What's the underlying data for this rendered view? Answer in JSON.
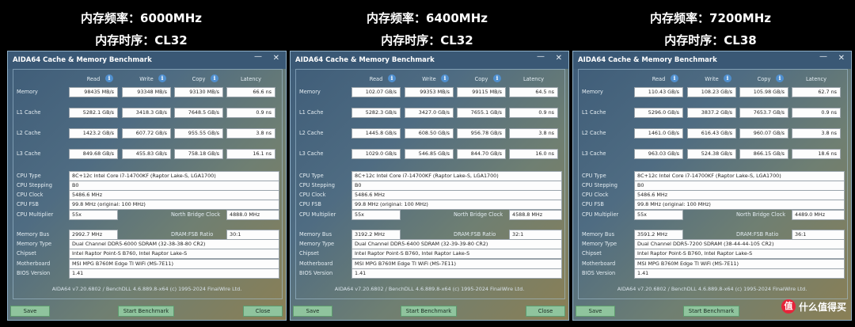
{
  "benchmarks": [
    {
      "header_freq": "内存频率：6000MHz",
      "header_cl": "内存时序：CL32",
      "title": "AIDA64 Cache & Memory Benchmark",
      "col_read": "Read",
      "col_write": "Write",
      "col_copy": "Copy",
      "col_latency": "Latency",
      "rows": [
        {
          "label": "Memory",
          "read": "98435 MB/s",
          "write": "93348 MB/s",
          "copy": "93130 MB/s",
          "latency": "66.6 ns"
        },
        {
          "label": "L1 Cache",
          "read": "5282.1 GB/s",
          "write": "3418.3 GB/s",
          "copy": "7648.5 GB/s",
          "latency": "0.9 ns"
        },
        {
          "label": "L2 Cache",
          "read": "1423.2 GB/s",
          "write": "607.72 GB/s",
          "copy": "955.55 GB/s",
          "latency": "3.8 ns"
        },
        {
          "label": "L3 Cache",
          "read": "849.68 GB/s",
          "write": "455.83 GB/s",
          "copy": "758.18 GB/s",
          "latency": "16.1 ns"
        }
      ],
      "cpu_type_label": "CPU Type",
      "cpu_type": "8C+12c Intel Core i7-14700KF  (Raptor Lake-S, LGA1700)",
      "cpu_stepping_label": "CPU Stepping",
      "cpu_stepping": "B0",
      "cpu_clock_label": "CPU Clock",
      "cpu_clock": "5486.6 MHz",
      "cpu_fsb_label": "CPU FSB",
      "cpu_fsb": "99.8 MHz  (original: 100 MHz)",
      "cpu_mult_label": "CPU Multiplier",
      "cpu_mult": "55x",
      "nb_clock_label": "North Bridge Clock",
      "nb_clock": "4888.0 MHz",
      "mem_bus_label": "Memory Bus",
      "mem_bus": "2992.7 MHz",
      "dram_ratio_label": "DRAM:FSB Ratio",
      "dram_ratio": "30:1",
      "mem_type_label": "Memory Type",
      "mem_type": "Dual Channel DDR5-6000 SDRAM  (32-38-38-80 CR2)",
      "chipset_label": "Chipset",
      "chipset": "Intel Raptor Point-S B760, Intel Raptor Lake-S",
      "mobo_label": "Motherboard",
      "mobo": "MSI MPG B760M Edge TI WiFi (MS-7E11)",
      "bios_label": "BIOS Version",
      "bios": "1.41",
      "footer": "AIDA64 v7.20.6802 / BenchDLL 4.6.889.8-x64  (c) 1995-2024 FinalWire Ltd.",
      "save": "Save",
      "start": "Start Benchmark",
      "close": "Close"
    },
    {
      "header_freq": "内存频率：6400MHz",
      "header_cl": "内存时序：CL32",
      "title": "AIDA64 Cache & Memory Benchmark",
      "col_read": "Read",
      "col_write": "Write",
      "col_copy": "Copy",
      "col_latency": "Latency",
      "rows": [
        {
          "label": "Memory",
          "read": "102.07 GB/s",
          "write": "99353 MB/s",
          "copy": "99115 MB/s",
          "latency": "64.5 ns"
        },
        {
          "label": "L1 Cache",
          "read": "5282.3 GB/s",
          "write": "3427.0 GB/s",
          "copy": "7655.1 GB/s",
          "latency": "0.9 ns"
        },
        {
          "label": "L2 Cache",
          "read": "1445.8 GB/s",
          "write": "608.50 GB/s",
          "copy": "956.78 GB/s",
          "latency": "3.8 ns"
        },
        {
          "label": "L3 Cache",
          "read": "1029.0 GB/s",
          "write": "546.85 GB/s",
          "copy": "844.70 GB/s",
          "latency": "16.0 ns"
        }
      ],
      "cpu_type_label": "CPU Type",
      "cpu_type": "8C+12c Intel Core i7-14700KF  (Raptor Lake-S, LGA1700)",
      "cpu_stepping_label": "CPU Stepping",
      "cpu_stepping": "B0",
      "cpu_clock_label": "CPU Clock",
      "cpu_clock": "5486.6 MHz",
      "cpu_fsb_label": "CPU FSB",
      "cpu_fsb": "99.8 MHz  (original: 100 MHz)",
      "cpu_mult_label": "CPU Multiplier",
      "cpu_mult": "55x",
      "nb_clock_label": "North Bridge Clock",
      "nb_clock": "4588.8 MHz",
      "mem_bus_label": "Memory Bus",
      "mem_bus": "3192.2 MHz",
      "dram_ratio_label": "DRAM:FSB Ratio",
      "dram_ratio": "32:1",
      "mem_type_label": "Memory Type",
      "mem_type": "Dual Channel DDR5-6400 SDRAM  (32-39-39-80 CR2)",
      "chipset_label": "Chipset",
      "chipset": "Intel Raptor Point-S B760, Intel Raptor Lake-S",
      "mobo_label": "Motherboard",
      "mobo": "MSI MPG B760M Edge TI WiFi (MS-7E11)",
      "bios_label": "BIOS Version",
      "bios": "1.41",
      "footer": "AIDA64 v7.20.6802 / BenchDLL 4.6.889.8-x64  (c) 1995-2024 FinalWire Ltd.",
      "save": "Save",
      "start": "Start Benchmark",
      "close": "Close"
    },
    {
      "header_freq": "内存频率：7200MHz",
      "header_cl": "内存时序：CL38",
      "title": "AIDA64 Cache & Memory Benchmark",
      "col_read": "Read",
      "col_write": "Write",
      "col_copy": "Copy",
      "col_latency": "Latency",
      "rows": [
        {
          "label": "Memory",
          "read": "110.43 GB/s",
          "write": "108.23 GB/s",
          "copy": "105.98 GB/s",
          "latency": "62.7 ns"
        },
        {
          "label": "L1 Cache",
          "read": "5296.0 GB/s",
          "write": "3837.2 GB/s",
          "copy": "7653.7 GB/s",
          "latency": "0.9 ns"
        },
        {
          "label": "L2 Cache",
          "read": "1461.0 GB/s",
          "write": "616.43 GB/s",
          "copy": "960.07 GB/s",
          "latency": "3.8 ns"
        },
        {
          "label": "L3 Cache",
          "read": "963.03 GB/s",
          "write": "524.38 GB/s",
          "copy": "866.15 GB/s",
          "latency": "18.6 ns"
        }
      ],
      "cpu_type_label": "CPU Type",
      "cpu_type": "8C+12c Intel Core i7-14700KF  (Raptor Lake-S, LGA1700)",
      "cpu_stepping_label": "CPU Stepping",
      "cpu_stepping": "B0",
      "cpu_clock_label": "CPU Clock",
      "cpu_clock": "5486.6 MHz",
      "cpu_fsb_label": "CPU FSB",
      "cpu_fsb": "99.8 MHz  (original: 100 MHz)",
      "cpu_mult_label": "CPU Multiplier",
      "cpu_mult": "55x",
      "nb_clock_label": "North Bridge Clock",
      "nb_clock": "4489.0 MHz",
      "mem_bus_label": "Memory Bus",
      "mem_bus": "3591.2 MHz",
      "dram_ratio_label": "DRAM:FSB Ratio",
      "dram_ratio": "36:1",
      "mem_type_label": "Memory Type",
      "mem_type": "Dual Channel DDR5-7200 SDRAM  (38-44-44-105 CR2)",
      "chipset_label": "Chipset",
      "chipset": "Intel Raptor Point-S B760, Intel Raptor Lake-S",
      "mobo_label": "Motherboard",
      "mobo": "MSI MPG B760M Edge TI WiFi (MS-7E11)",
      "bios_label": "BIOS Version",
      "bios": "1.41",
      "footer": "AIDA64 v7.20.6802 / BenchDLL 4.6.889.8-x64  (c) 1995-2024 FinalWire Ltd.",
      "save": "Save",
      "start": "Start Benchmark",
      "close": "Close"
    }
  ],
  "watermark": {
    "icon": "zhi-logo-icon",
    "logo_char": "值",
    "text": "什么值得买"
  }
}
